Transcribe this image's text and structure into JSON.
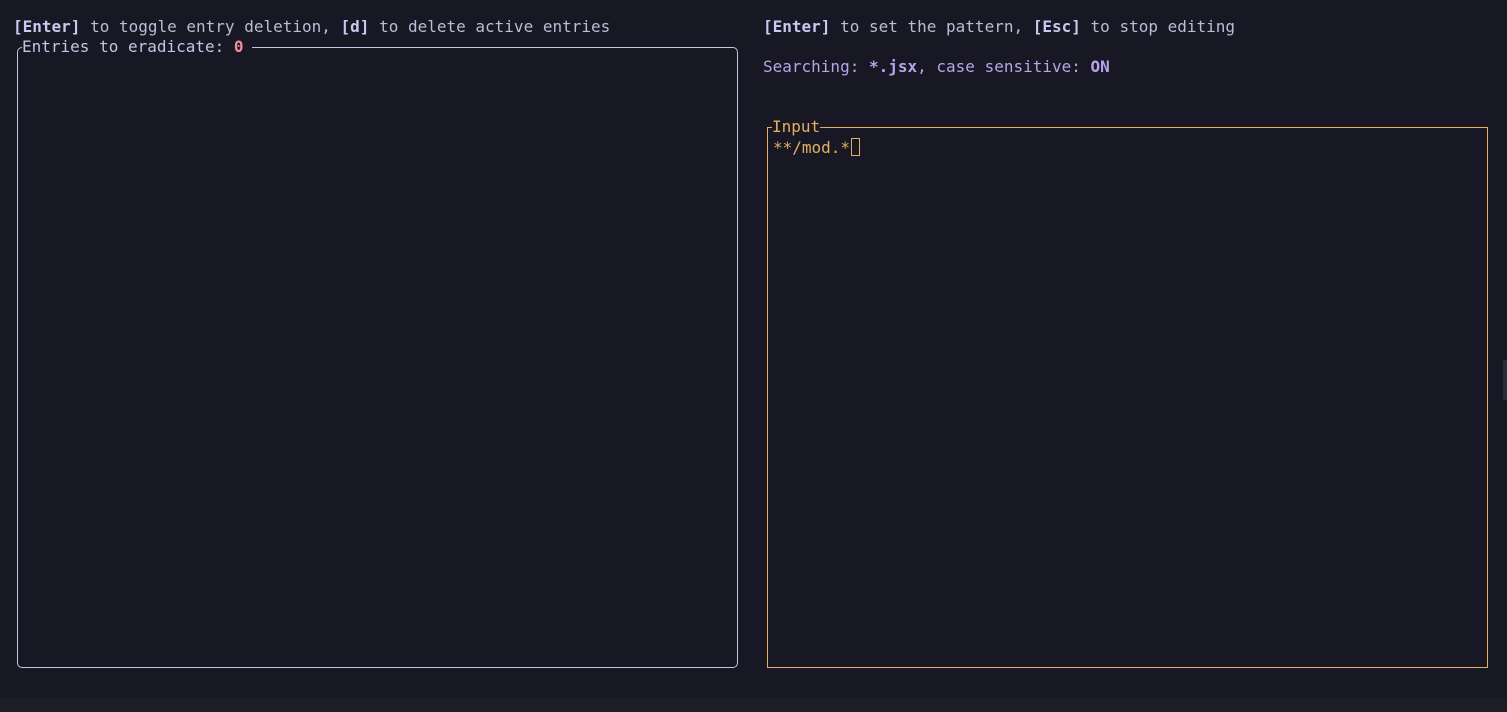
{
  "left_help": {
    "key1": "[Enter]",
    "text1": " to toggle entry deletion, ",
    "key2": "[d]",
    "text2": " to delete active entries"
  },
  "right_help": {
    "key1": "[Enter]",
    "text1": " to set the pattern, ",
    "key2": "[Esc]",
    "text2": " to stop editing"
  },
  "search_status": {
    "label": "Searching: ",
    "pattern": "*.jsx",
    "sep": ", case sensitive: ",
    "case_value": "ON"
  },
  "entries_panel": {
    "title_label": "Entries to eradicate: ",
    "count": "0"
  },
  "input_panel": {
    "title": "Input",
    "value": "**/mod.*"
  },
  "colors": {
    "background": "#181824",
    "text": "#bcbcd6",
    "accent_mauve": "#b8a4e8",
    "count_red": "#f08c9c",
    "input_yellow": "#e3b061",
    "panel_border": "#c4c4e4"
  }
}
